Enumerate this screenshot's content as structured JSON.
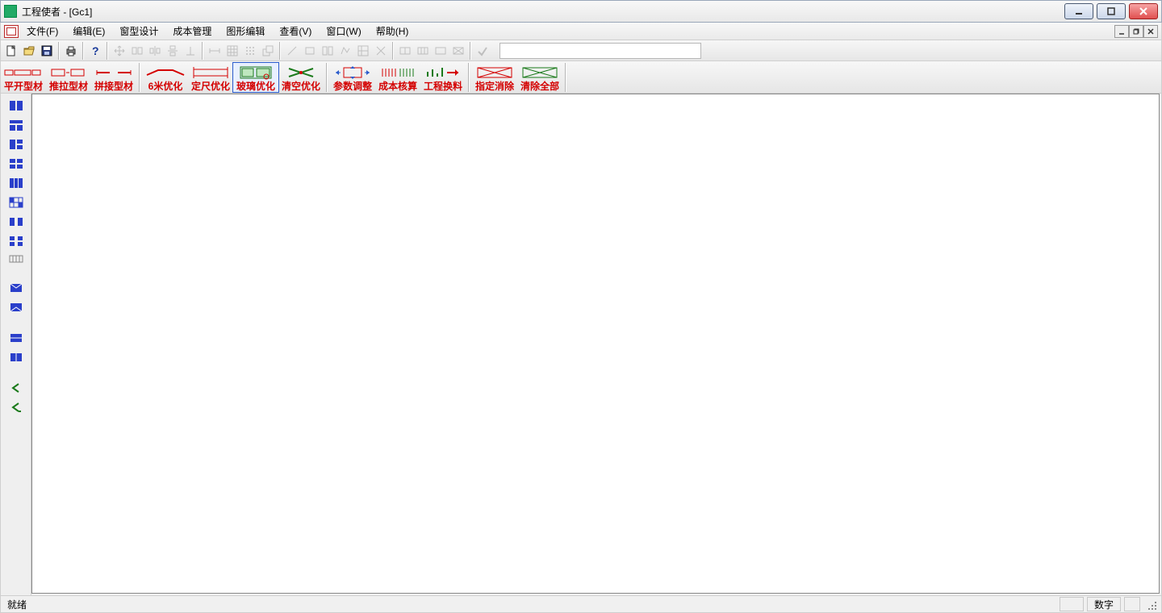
{
  "title": "工程使者 - [Gc1]",
  "menu": {
    "items": [
      "文件(F)",
      "编辑(E)",
      "窗型设计",
      "成本管理",
      "图形编辑",
      "查看(V)",
      "窗口(W)",
      "帮助(H)"
    ]
  },
  "bigtoolbar": {
    "items": [
      {
        "label": "平开型材",
        "icon": "profile-flat"
      },
      {
        "label": "推拉型材",
        "icon": "profile-slide"
      },
      {
        "label": "拼接型材",
        "icon": "profile-join"
      },
      {
        "label": "6米优化",
        "icon": "opt-6m"
      },
      {
        "label": "定尺优化",
        "icon": "opt-fixed"
      },
      {
        "label": "玻璃优化",
        "icon": "opt-glass"
      },
      {
        "label": "清空优化",
        "icon": "opt-clear"
      },
      {
        "label": "参数调整",
        "icon": "param-adjust"
      },
      {
        "label": "成本核算",
        "icon": "cost-calc"
      },
      {
        "label": "工程换料",
        "icon": "swap-material"
      },
      {
        "label": "指定消除",
        "icon": "remove-one"
      },
      {
        "label": "清除全部",
        "icon": "remove-all"
      }
    ],
    "selected_index": 5
  },
  "toolbar_icons": {
    "new": "new-file-icon",
    "open": "open-file-icon",
    "save": "save-file-icon",
    "print": "print-icon",
    "help": "help-icon",
    "move": "move-icon",
    "copy": "copy-icon",
    "mirrorh": "mirror-h-icon",
    "mirrorv": "mirror-v-icon",
    "rotate": "rotate-icon",
    "dim": "dimension-icon",
    "grid": "grid-icon",
    "snap": "snap-icon",
    "layer": "layer-icon",
    "line": "line-icon",
    "rect": "rect-icon",
    "rects": "rects-icon",
    "poly": "poly-icon",
    "group": "group-icon",
    "ungroup": "ungroup-icon",
    "g1": "shape1-icon",
    "g2": "shape2-icon",
    "g3": "shape3-icon",
    "g4": "shape4-icon",
    "check": "check-icon"
  },
  "status": {
    "ready": "就绪",
    "num": "数字"
  }
}
